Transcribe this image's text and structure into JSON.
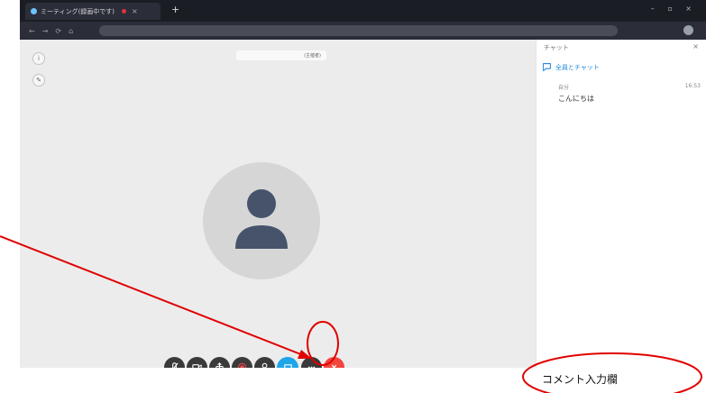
{
  "browser": {
    "tab_title": "ミーティング(録画中です)",
    "tab_close": "×",
    "new_tab": "+",
    "window_controls": "– ▫ ×"
  },
  "meeting": {
    "name_suffix": "(主催者)"
  },
  "controls": [
    {
      "name": "mute-mic",
      "icon": "mic-off-icon"
    },
    {
      "name": "video",
      "icon": "camera-icon"
    },
    {
      "name": "share",
      "icon": "share-icon"
    },
    {
      "name": "record",
      "icon": "record-icon"
    },
    {
      "name": "participants",
      "icon": "person-icon"
    },
    {
      "name": "chat",
      "icon": "chat-bubble-icon"
    },
    {
      "name": "more",
      "icon": "more-icon"
    },
    {
      "name": "leave",
      "icon": "close-icon"
    }
  ],
  "chat": {
    "header": "チャット",
    "close": "×",
    "tab_label": "全員とチャット",
    "message": {
      "sender": "自分",
      "time": "16:53",
      "text": "こんにちは"
    }
  },
  "annotation": {
    "comment_label": "コメント入力欄",
    "color": "#e00000"
  }
}
